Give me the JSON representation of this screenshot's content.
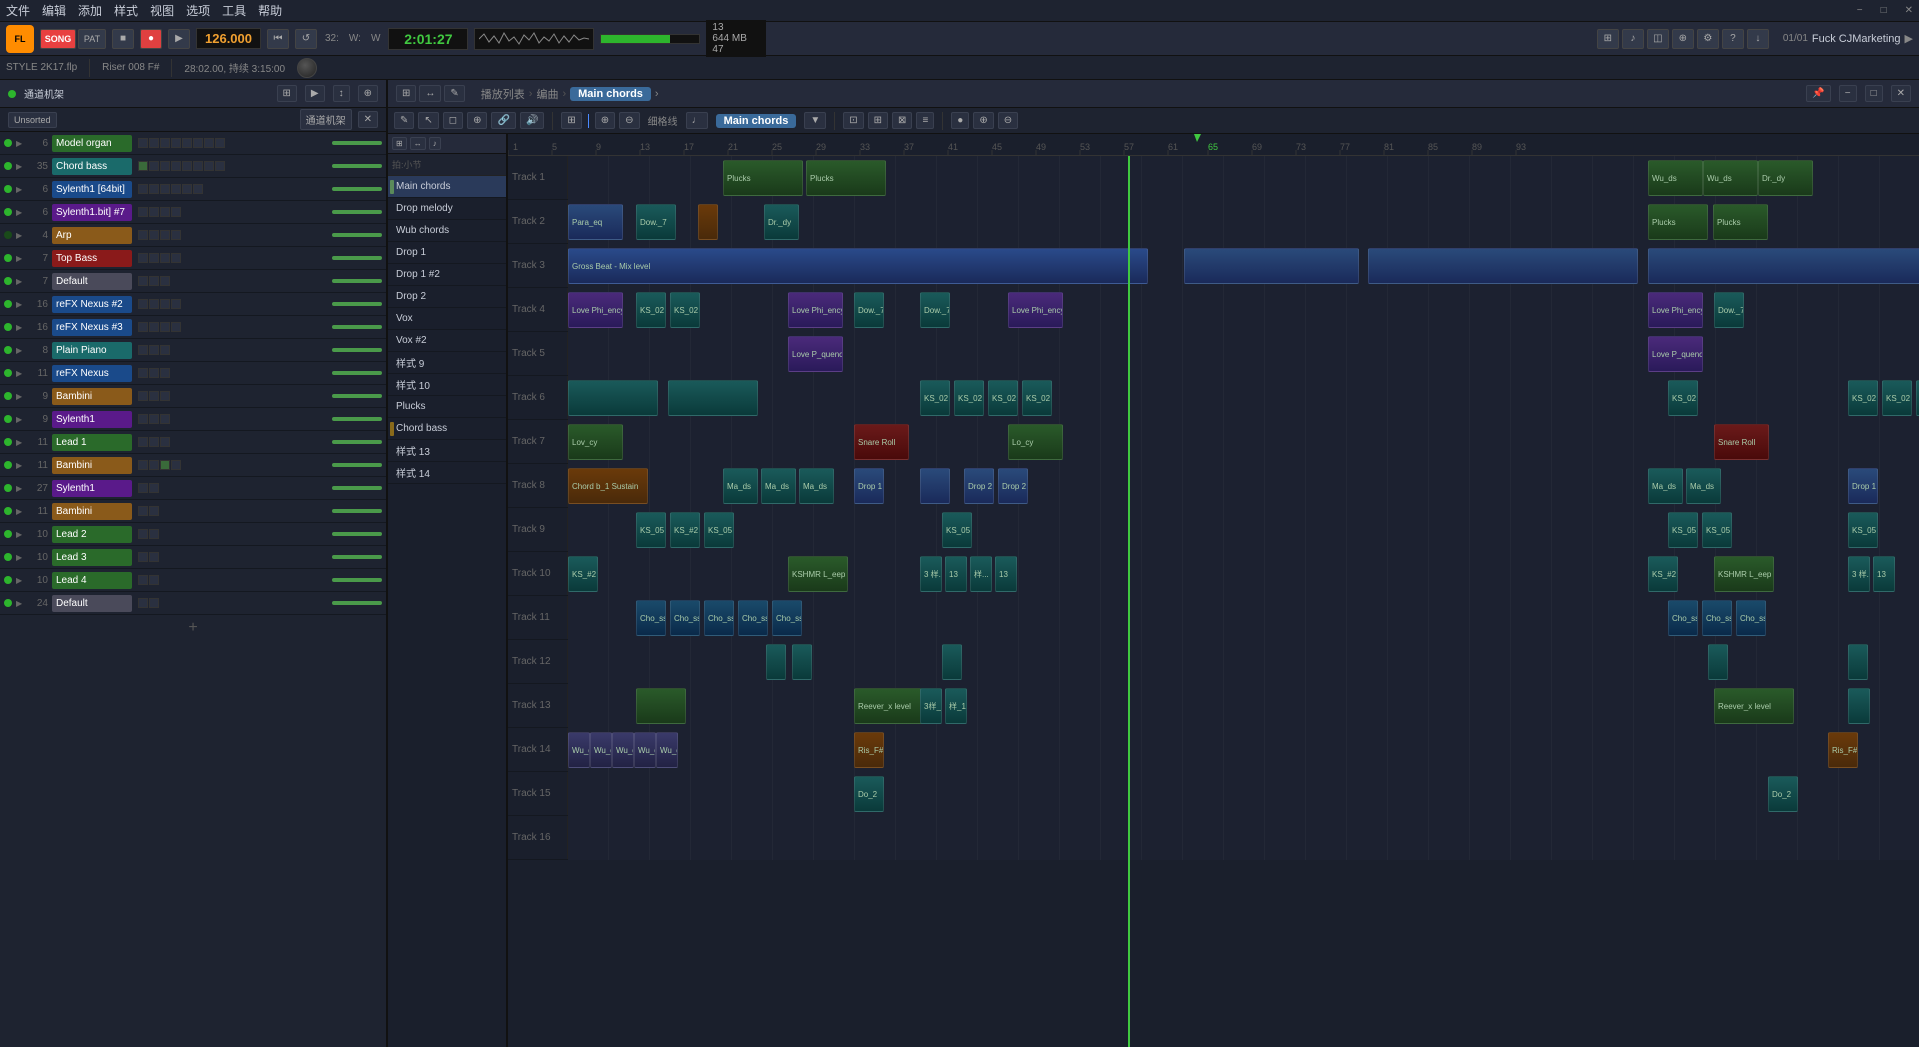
{
  "app": {
    "title": "STYLE 2K17.flp",
    "time_info": "28:02.00, 持续 3:15:00"
  },
  "menu": {
    "items": [
      "文件",
      "编辑",
      "添加",
      "样式",
      "视图",
      "选项",
      "工具",
      "帮助"
    ]
  },
  "transport": {
    "bpm": "126.000",
    "time": "2:01:27",
    "song_label": "SONG",
    "cpu_label": "13",
    "ram_label": "644 MB",
    "voice_label": "47"
  },
  "info_bar": {
    "style": "STYLE 2K17.flp",
    "preset": "Riser 008 F#",
    "duration": "28:02.00, 持续 3:15:00"
  },
  "mixer": {
    "header": "通道机架",
    "sort": "Unsorted",
    "tracks": [
      {
        "num": 6,
        "name": "Model organ",
        "color": "green"
      },
      {
        "num": 35,
        "name": "Chord bass",
        "color": "teal"
      },
      {
        "num": 6,
        "name": "Sylenth1 [64bit]",
        "color": "blue"
      },
      {
        "num": 6,
        "name": "Sylenth1.bit] #7",
        "color": "purple"
      },
      {
        "num": 4,
        "name": "Arp",
        "color": "orange"
      },
      {
        "num": 7,
        "name": "Top Bass",
        "color": "red"
      },
      {
        "num": 7,
        "name": "Default",
        "color": "gray"
      },
      {
        "num": 16,
        "name": "reFX Nexus #2",
        "color": "blue"
      },
      {
        "num": 16,
        "name": "reFX Nexus #3",
        "color": "blue"
      },
      {
        "num": 8,
        "name": "Plain Piano",
        "color": "teal"
      },
      {
        "num": 11,
        "name": "reFX Nexus",
        "color": "blue"
      },
      {
        "num": 9,
        "name": "Bambini",
        "color": "orange"
      },
      {
        "num": 9,
        "name": "Sylenth1",
        "color": "purple"
      },
      {
        "num": 11,
        "name": "Lead 1",
        "color": "green"
      },
      {
        "num": 11,
        "name": "Bambini",
        "color": "orange"
      },
      {
        "num": 27,
        "name": "Sylenth1",
        "color": "purple"
      },
      {
        "num": 11,
        "name": "Bambini",
        "color": "orange"
      },
      {
        "num": 10,
        "name": "Lead 2",
        "color": "green"
      },
      {
        "num": 10,
        "name": "Lead 3",
        "color": "green"
      },
      {
        "num": 10,
        "name": "Lead 4",
        "color": "green"
      },
      {
        "num": 24,
        "name": "Default",
        "color": "gray"
      }
    ]
  },
  "playlist": {
    "title": "Main chords",
    "breadcrumb": [
      "播放列表",
      "编曲",
      "Main chords"
    ],
    "patterns": [
      {
        "name": "Main chords",
        "active": true
      },
      {
        "name": "Drop melody",
        "active": false
      },
      {
        "name": "Wub chords",
        "active": false
      },
      {
        "name": "Drop 1",
        "active": false
      },
      {
        "name": "Drop 1 #2",
        "active": false
      },
      {
        "name": "Drop 2",
        "active": false
      },
      {
        "name": "Vox",
        "active": false
      },
      {
        "name": "Vox #2",
        "active": false
      },
      {
        "name": "样式 9",
        "active": false
      },
      {
        "name": "样式 10",
        "active": false
      },
      {
        "name": "Plucks",
        "active": false
      },
      {
        "name": "Chord bass",
        "active": false
      },
      {
        "name": "样式 13",
        "active": false
      },
      {
        "name": "样式 14",
        "active": false
      }
    ],
    "tracks": [
      "Track 1",
      "Track 2",
      "Track 3",
      "Track 4",
      "Track 5",
      "Track 6",
      "Track 7",
      "Track 8",
      "Track 9",
      "Track 10",
      "Track 11",
      "Track 12",
      "Track 13",
      "Track 14",
      "Track 15",
      "Track 16"
    ],
    "ruler_marks": [
      "1",
      "5",
      "9",
      "13",
      "17",
      "21",
      "25",
      "29",
      "33",
      "37",
      "41",
      "45",
      "49",
      "53",
      "57",
      "61",
      "65",
      "69",
      "73",
      "77",
      "81",
      "85",
      "89",
      "93"
    ]
  },
  "icons": {
    "play": "▶",
    "pause": "⏸",
    "stop": "■",
    "record": "●",
    "rewind": "⏮",
    "forward": "⏭",
    "loop": "↺",
    "arrow_right": "▶",
    "arrow_down": "▼",
    "close": "✕",
    "minimize": "−",
    "maximize": "□",
    "pencil": "✎",
    "magnet": "⊕",
    "scissors": "✂",
    "note": "♪",
    "piano": "🎹",
    "settings": "⚙"
  },
  "colors": {
    "bg_dark": "#1a1f2c",
    "bg_mid": "#252a3a",
    "bg_light": "#2a3040",
    "accent_green": "#2db52d",
    "accent_blue": "#4a8aff",
    "accent_orange": "#e08020",
    "accent_red": "#e04040",
    "text_light": "#c8cdd8",
    "text_dim": "#666"
  }
}
